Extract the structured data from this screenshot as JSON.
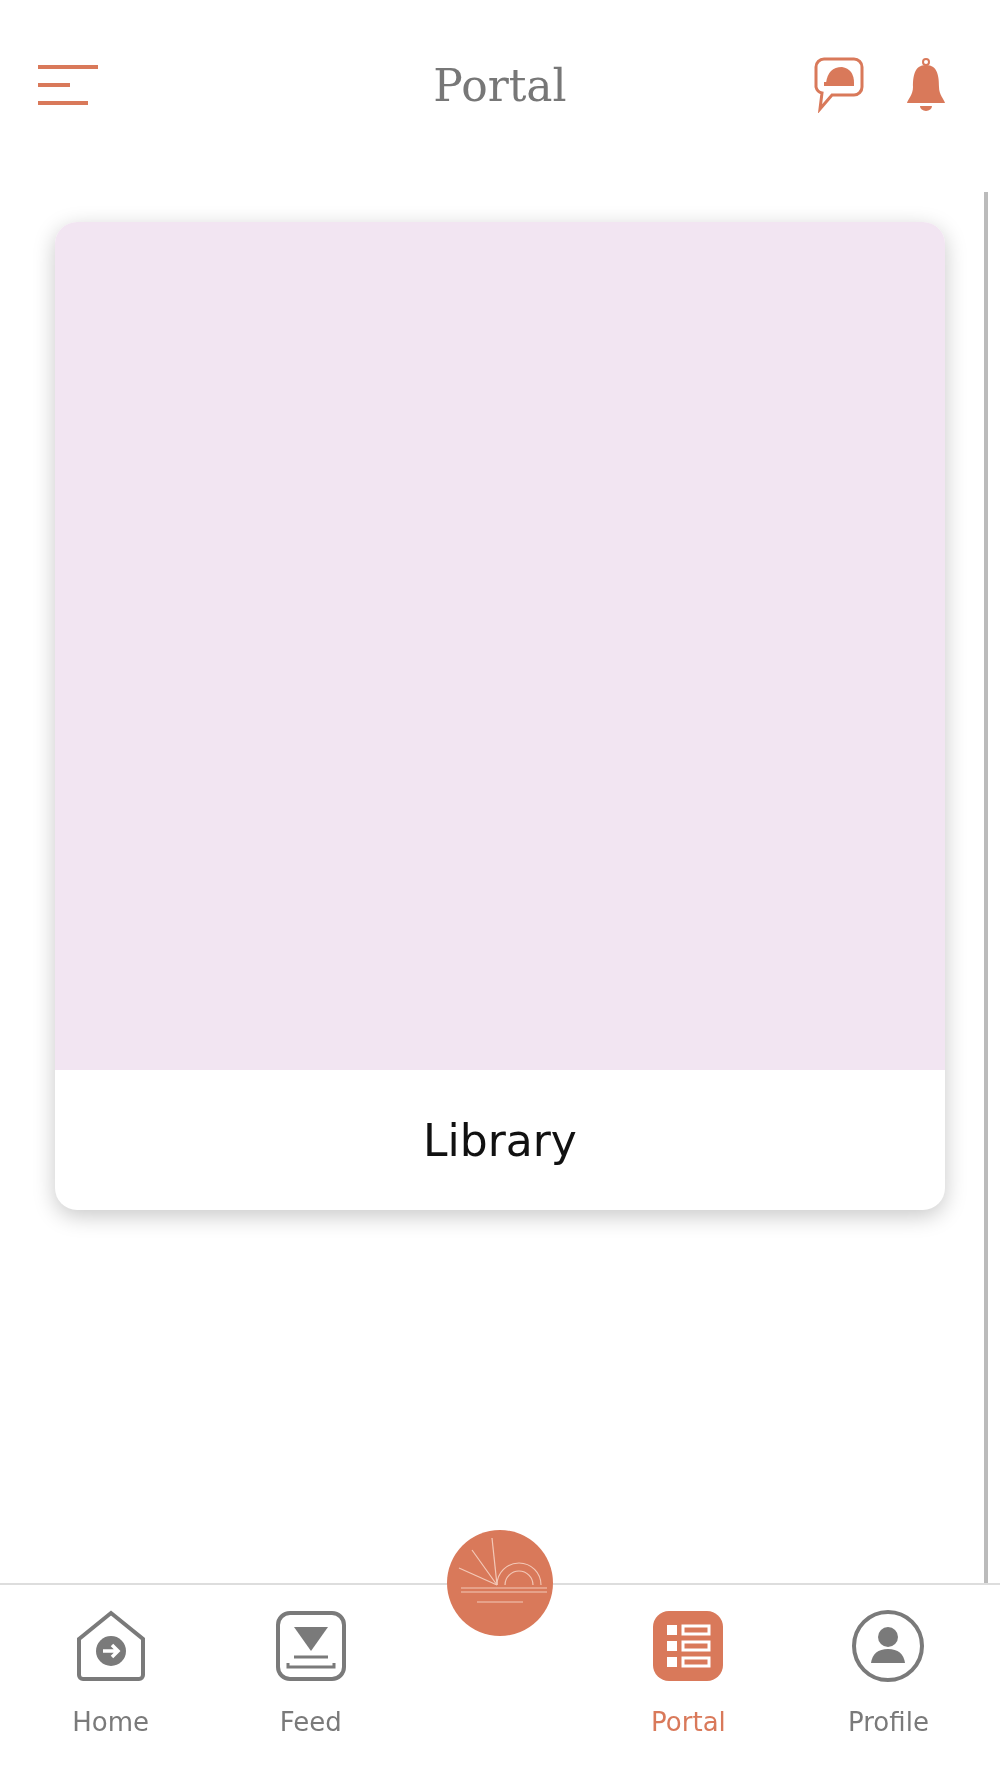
{
  "header": {
    "title": "Portal"
  },
  "cards": [
    {
      "label": "Library"
    }
  ],
  "tabs": [
    {
      "label": "Home",
      "kind": "home",
      "selected": false
    },
    {
      "label": "Feed",
      "kind": "feed",
      "selected": false
    },
    {
      "label": "Portal",
      "kind": "portal",
      "selected": true
    },
    {
      "label": "Profile",
      "kind": "profile",
      "selected": false
    }
  ]
}
